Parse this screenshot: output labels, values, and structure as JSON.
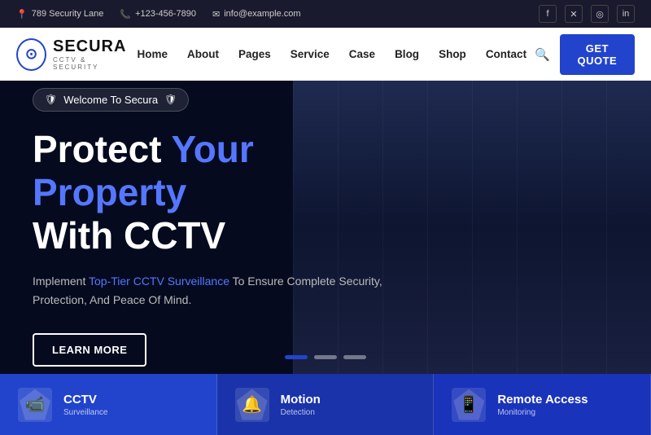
{
  "topbar": {
    "address": "789 Security Lane",
    "phone": "+123-456-7890",
    "email": "info@example.com",
    "socials": [
      "f",
      "𝕏",
      "📷",
      "in"
    ]
  },
  "navbar": {
    "logo_name": "SECURA",
    "logo_sub": "CCTV & SECURITY",
    "links": [
      "Home",
      "About",
      "Pages",
      "Service",
      "Case",
      "Blog",
      "Shop",
      "Contact"
    ],
    "cta_label": "GET QUOTE"
  },
  "hero": {
    "badge": "Welcome To Secura",
    "title_part1": "Protect ",
    "title_highlight": "Your Property",
    "title_part2": "With CCTV",
    "description_part1": "Implement ",
    "description_accent": "Top-Tier CCTV Surveillance",
    "description_part2": " To Ensure Complete Security, Protection, And Peace Of Mind.",
    "cta_label": "LEARN MORE",
    "dots": [
      true,
      false,
      false
    ]
  },
  "bottom_cards": [
    {
      "icon": "📹",
      "title": "CCTV",
      "subtitle": "Surveillance"
    },
    {
      "icon": "🔔",
      "title": "Motion",
      "subtitle": "Detection"
    },
    {
      "icon": "📱",
      "title": "Remote Access",
      "subtitle": "Monitoring"
    }
  ]
}
